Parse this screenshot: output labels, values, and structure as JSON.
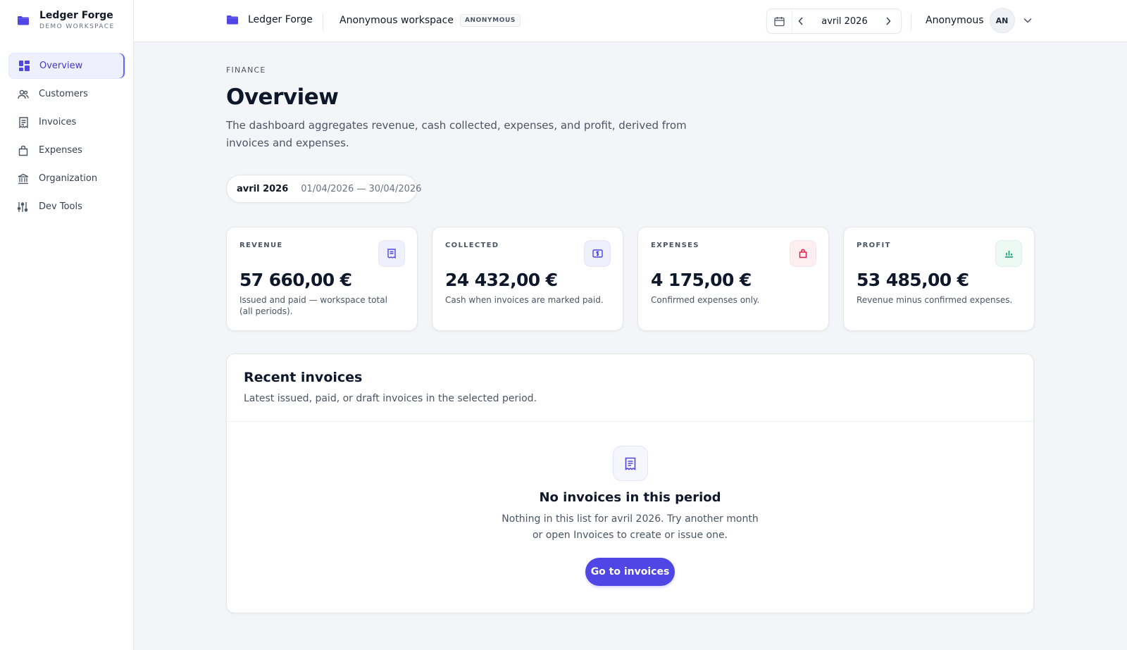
{
  "brand": {
    "name": "Ledger Forge",
    "subtitle": "DEMO WORKSPACE"
  },
  "sidebar": {
    "items": [
      {
        "label": "Overview",
        "icon": "grid-icon",
        "active": true
      },
      {
        "label": "Customers",
        "icon": "users-icon"
      },
      {
        "label": "Invoices",
        "icon": "receipt-icon"
      },
      {
        "label": "Expenses",
        "icon": "bag-icon"
      },
      {
        "label": "Organization",
        "icon": "bank-icon"
      },
      {
        "label": "Dev Tools",
        "icon": "sliders-icon"
      }
    ]
  },
  "topbar": {
    "brand": "Ledger Forge",
    "workspace": "Anonymous workspace",
    "badge": "ANONYMOUS",
    "period": "avril 2026",
    "user_name": "Anonymous",
    "avatar_initials": "AN"
  },
  "page": {
    "eyebrow": "FINANCE",
    "title": "Overview",
    "description": "The dashboard aggregates revenue, cash collected, expenses, and profit, derived from invoices and expenses."
  },
  "period_chip": {
    "month": "avril 2026",
    "range": "01/04/2026 — 30/04/2026"
  },
  "cards": [
    {
      "label": "REVENUE",
      "value": "57 660,00 €",
      "note": "Issued and paid — workspace total (all periods).",
      "icon": "receipt-icon",
      "color": "#4f46e5"
    },
    {
      "label": "COLLECTED",
      "value": "24 432,00 €",
      "note": "Cash when invoices are marked paid.",
      "icon": "cash-icon",
      "color": "#4f46e5"
    },
    {
      "label": "EXPENSES",
      "value": "4 175,00 €",
      "note": "Confirmed expenses only.",
      "icon": "bag-icon",
      "color": "#e11d48"
    },
    {
      "label": "PROFIT",
      "value": "53 485,00 €",
      "note": "Revenue minus confirmed expenses.",
      "icon": "bar-chart-icon",
      "color": "#059669"
    }
  ],
  "recent": {
    "title": "Recent invoices",
    "subtitle": "Latest issued, paid, or draft invoices in the selected period.",
    "empty_title": "No invoices in this period",
    "empty_text": "Nothing in this list for avril 2026. Try another month or open Invoices to create or issue one.",
    "button": "Go to invoices"
  },
  "colors": {
    "accent": "#4f46e5",
    "active_bg": "#eef0fd",
    "expense": "#e11d48",
    "profit": "#059669"
  }
}
